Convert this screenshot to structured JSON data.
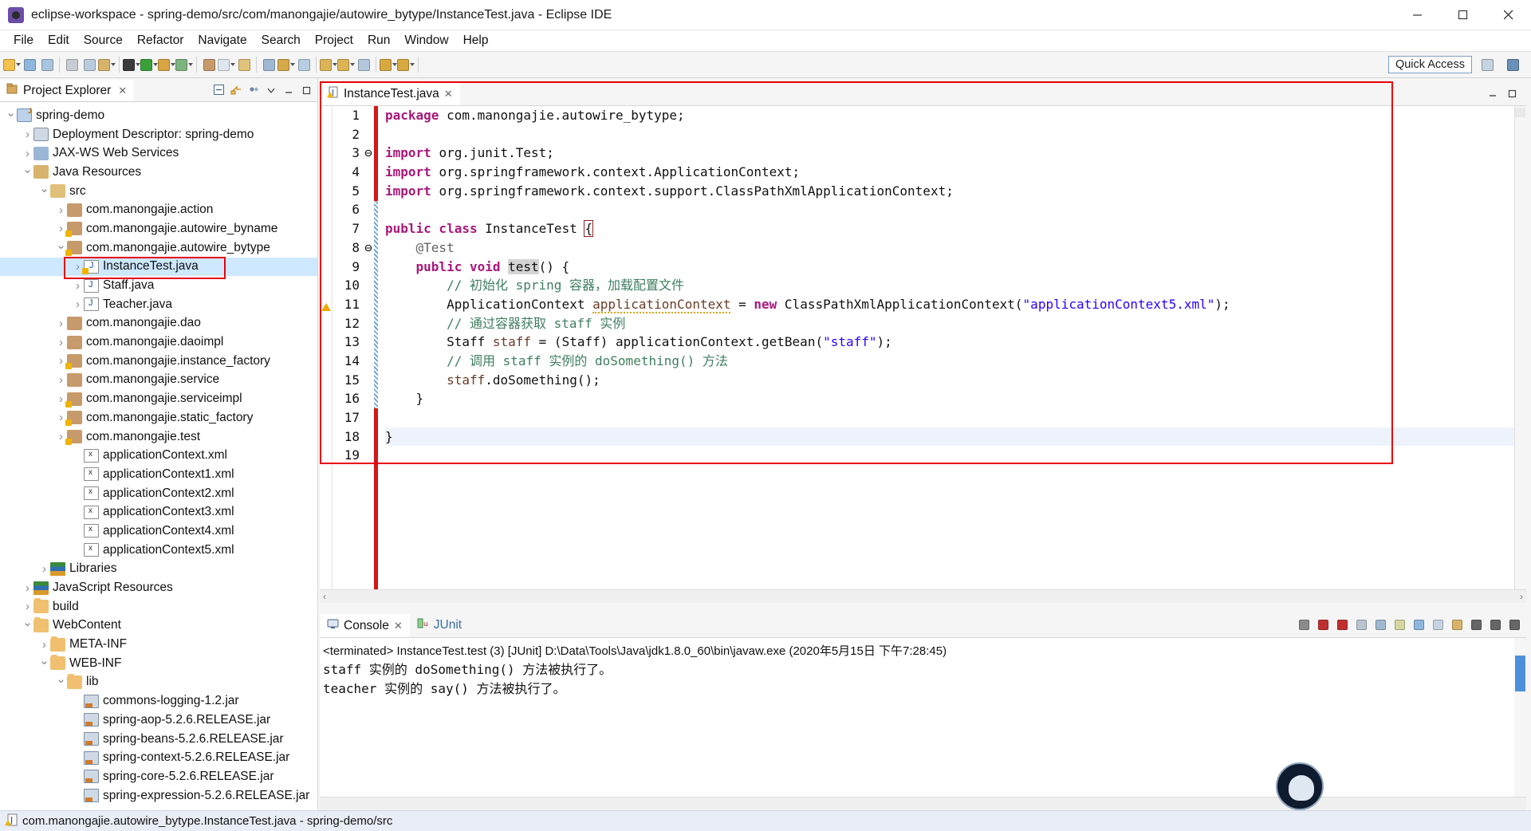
{
  "window": {
    "title": "eclipse-workspace - spring-demo/src/com/manongajie/autowire_bytype/InstanceTest.java - Eclipse IDE",
    "app_icon": "eclipse-icon",
    "minimize_label": "–",
    "maximize_label": "❐",
    "close_label": "✕"
  },
  "menubar": {
    "items": [
      "File",
      "Edit",
      "Source",
      "Refactor",
      "Navigate",
      "Search",
      "Project",
      "Run",
      "Window",
      "Help"
    ]
  },
  "toolbar": {
    "quick_access_label": "Quick Access",
    "groups": [
      [
        {
          "name": "new-wizard-icon",
          "color": "#f2c14e",
          "caret": true
        },
        {
          "name": "save-icon",
          "color": "#8fb7dd",
          "caret": false
        },
        {
          "name": "save-all-icon",
          "color": "#a8c4de",
          "caret": false
        }
      ],
      [
        {
          "name": "print-icon",
          "color": "#c8cdd4",
          "caret": false
        },
        {
          "name": "build-all-icon",
          "color": "#b9ccde",
          "caret": false
        },
        {
          "name": "export-icon",
          "color": "#d8b46b",
          "caret": true
        }
      ],
      [
        {
          "name": "debug-icon",
          "color": "#3b3b3b",
          "caret": true
        },
        {
          "name": "run-icon",
          "color": "#3aa03a",
          "caret": true
        },
        {
          "name": "run-external-tools-icon",
          "color": "#d9a441",
          "caret": true
        },
        {
          "name": "coverage-icon",
          "color": "#7db37d",
          "caret": true
        }
      ],
      [
        {
          "name": "new-java-package-icon",
          "color": "#c79a6b",
          "caret": false
        },
        {
          "name": "new-java-class-icon",
          "color": "#dfe6ee",
          "caret": true
        },
        {
          "name": "new-annotation-icon",
          "color": "#e0c27a",
          "caret": false
        }
      ],
      [
        {
          "name": "search-icon",
          "color": "#9fb8d2",
          "caret": false
        },
        {
          "name": "open-task-icon",
          "color": "#d6a94b",
          "caret": true
        },
        {
          "name": "open-type-icon",
          "color": "#b6cde2",
          "caret": false
        }
      ],
      [
        {
          "name": "next-annotation-icon",
          "color": "#dcb455",
          "caret": true
        },
        {
          "name": "previous-annotation-icon",
          "color": "#dcb455",
          "caret": true
        },
        {
          "name": "last-edit-location-icon",
          "color": "#b2c7dc",
          "caret": false
        }
      ],
      [
        {
          "name": "back-icon",
          "color": "#d8a93f",
          "caret": true
        },
        {
          "name": "forward-icon",
          "color": "#d8a93f",
          "caret": true
        }
      ]
    ],
    "perspective_buttons": [
      {
        "name": "open-perspective-icon",
        "color": "#c6d4e2"
      },
      {
        "name": "java-ee-perspective-icon",
        "color": "#6b90b8"
      }
    ]
  },
  "explorer": {
    "tab_label": "Project Explorer",
    "tab_close": "✕",
    "tools": [
      {
        "name": "collapse-all-icon"
      },
      {
        "name": "link-with-editor-icon"
      },
      {
        "name": "view-menu-icon"
      },
      {
        "name": "minimize-view-icon"
      },
      {
        "name": "maximize-view-icon"
      }
    ],
    "tree": [
      {
        "label": "spring-demo",
        "depth": 0,
        "arrow": "open",
        "icon": "ic-proj",
        "selected": false,
        "boxed": false
      },
      {
        "label": "Deployment Descriptor: spring-demo",
        "depth": 1,
        "arrow": "closed",
        "icon": "ic-deploy",
        "selected": false,
        "boxed": false
      },
      {
        "label": "JAX-WS Web Services",
        "depth": 1,
        "arrow": "closed",
        "icon": "ic-jaxws",
        "selected": false,
        "boxed": false
      },
      {
        "label": "Java Resources",
        "depth": 1,
        "arrow": "open",
        "icon": "ic-jres",
        "selected": false,
        "boxed": false
      },
      {
        "label": "src",
        "depth": 2,
        "arrow": "open",
        "icon": "ic-src",
        "selected": false,
        "boxed": false
      },
      {
        "label": "com.manongajie.action",
        "depth": 3,
        "arrow": "closed",
        "icon": "ic-pkg",
        "selected": false,
        "boxed": false
      },
      {
        "label": "com.manongajie.autowire_byname",
        "depth": 3,
        "arrow": "closed",
        "icon": "ic-pkgw",
        "selected": false,
        "boxed": false
      },
      {
        "label": "com.manongajie.autowire_bytype",
        "depth": 3,
        "arrow": "open",
        "icon": "ic-pkgw",
        "selected": false,
        "boxed": false
      },
      {
        "label": "InstanceTest.java",
        "depth": 4,
        "arrow": "closed",
        "icon": "ic-javaw",
        "selected": true,
        "boxed": true
      },
      {
        "label": "Staff.java",
        "depth": 4,
        "arrow": "closed",
        "icon": "ic-java",
        "selected": false,
        "boxed": false
      },
      {
        "label": "Teacher.java",
        "depth": 4,
        "arrow": "closed",
        "icon": "ic-java",
        "selected": false,
        "boxed": false
      },
      {
        "label": "com.manongajie.dao",
        "depth": 3,
        "arrow": "closed",
        "icon": "ic-pkg",
        "selected": false,
        "boxed": false
      },
      {
        "label": "com.manongajie.daoimpl",
        "depth": 3,
        "arrow": "closed",
        "icon": "ic-pkg",
        "selected": false,
        "boxed": false
      },
      {
        "label": "com.manongajie.instance_factory",
        "depth": 3,
        "arrow": "closed",
        "icon": "ic-pkgw",
        "selected": false,
        "boxed": false
      },
      {
        "label": "com.manongajie.service",
        "depth": 3,
        "arrow": "closed",
        "icon": "ic-pkg",
        "selected": false,
        "boxed": false
      },
      {
        "label": "com.manongajie.serviceimpl",
        "depth": 3,
        "arrow": "closed",
        "icon": "ic-pkgw",
        "selected": false,
        "boxed": false
      },
      {
        "label": "com.manongajie.static_factory",
        "depth": 3,
        "arrow": "closed",
        "icon": "ic-pkgw",
        "selected": false,
        "boxed": false
      },
      {
        "label": "com.manongajie.test",
        "depth": 3,
        "arrow": "closed",
        "icon": "ic-pkgw",
        "selected": false,
        "boxed": false
      },
      {
        "label": "applicationContext.xml",
        "depth": 4,
        "arrow": "none",
        "icon": "ic-xml",
        "selected": false,
        "boxed": false
      },
      {
        "label": "applicationContext1.xml",
        "depth": 4,
        "arrow": "none",
        "icon": "ic-xml",
        "selected": false,
        "boxed": false
      },
      {
        "label": "applicationContext2.xml",
        "depth": 4,
        "arrow": "none",
        "icon": "ic-xml",
        "selected": false,
        "boxed": false
      },
      {
        "label": "applicationContext3.xml",
        "depth": 4,
        "arrow": "none",
        "icon": "ic-xml",
        "selected": false,
        "boxed": false
      },
      {
        "label": "applicationContext4.xml",
        "depth": 4,
        "arrow": "none",
        "icon": "ic-xml",
        "selected": false,
        "boxed": false
      },
      {
        "label": "applicationContext5.xml",
        "depth": 4,
        "arrow": "none",
        "icon": "ic-xml",
        "selected": false,
        "boxed": false
      },
      {
        "label": "Libraries",
        "depth": 2,
        "arrow": "closed",
        "icon": "ic-lib",
        "selected": false,
        "boxed": false
      },
      {
        "label": "JavaScript Resources",
        "depth": 1,
        "arrow": "closed",
        "icon": "ic-lib",
        "selected": false,
        "boxed": false
      },
      {
        "label": "build",
        "depth": 1,
        "arrow": "closed",
        "icon": "ic-folder",
        "selected": false,
        "boxed": false
      },
      {
        "label": "WebContent",
        "depth": 1,
        "arrow": "open",
        "icon": "ic-folder",
        "selected": false,
        "boxed": false
      },
      {
        "label": "META-INF",
        "depth": 2,
        "arrow": "closed",
        "icon": "ic-folder",
        "selected": false,
        "boxed": false
      },
      {
        "label": "WEB-INF",
        "depth": 2,
        "arrow": "open",
        "icon": "ic-folder",
        "selected": false,
        "boxed": false
      },
      {
        "label": "lib",
        "depth": 3,
        "arrow": "open",
        "icon": "ic-folder",
        "selected": false,
        "boxed": false
      },
      {
        "label": "commons-logging-1.2.jar",
        "depth": 4,
        "arrow": "none",
        "icon": "ic-jar",
        "selected": false,
        "boxed": false
      },
      {
        "label": "spring-aop-5.2.6.RELEASE.jar",
        "depth": 4,
        "arrow": "none",
        "icon": "ic-jar",
        "selected": false,
        "boxed": false
      },
      {
        "label": "spring-beans-5.2.6.RELEASE.jar",
        "depth": 4,
        "arrow": "none",
        "icon": "ic-jar",
        "selected": false,
        "boxed": false
      },
      {
        "label": "spring-context-5.2.6.RELEASE.jar",
        "depth": 4,
        "arrow": "none",
        "icon": "ic-jar",
        "selected": false,
        "boxed": false
      },
      {
        "label": "spring-core-5.2.6.RELEASE.jar",
        "depth": 4,
        "arrow": "none",
        "icon": "ic-jar",
        "selected": false,
        "boxed": false
      },
      {
        "label": "spring-expression-5.2.6.RELEASE.jar",
        "depth": 4,
        "arrow": "none",
        "icon": "ic-jar",
        "selected": false,
        "boxed": false
      }
    ]
  },
  "editor": {
    "tab_label": "InstanceTest.java",
    "tab_close": "✕",
    "tab_icon": "java-warning-file-icon",
    "line_numbers": [
      "1",
      "2",
      "3",
      "4",
      "5",
      "6",
      "7",
      "8",
      "9",
      "10",
      "11",
      "12",
      "13",
      "14",
      "15",
      "16",
      "17",
      "18",
      "19"
    ],
    "fold_markers": {
      "3": "⊖",
      "8": "⊖"
    },
    "warning_line": 11,
    "current_line": 18,
    "code_lines": [
      {
        "n": 1,
        "segments": [
          {
            "t": "package ",
            "c": "k"
          },
          {
            "t": "com.manongajie.autowire_bytype;",
            "c": ""
          }
        ]
      },
      {
        "n": 2,
        "segments": []
      },
      {
        "n": 3,
        "segments": [
          {
            "t": "import ",
            "c": "k"
          },
          {
            "t": "org.junit.Test;",
            "c": ""
          }
        ]
      },
      {
        "n": 4,
        "segments": [
          {
            "t": "import ",
            "c": "k"
          },
          {
            "t": "org.springframework.context.ApplicationContext;",
            "c": ""
          }
        ]
      },
      {
        "n": 5,
        "segments": [
          {
            "t": "import ",
            "c": "k"
          },
          {
            "t": "org.springframework.context.support.ClassPathXmlApplicationContext;",
            "c": ""
          }
        ]
      },
      {
        "n": 6,
        "segments": []
      },
      {
        "n": 7,
        "segments": [
          {
            "t": "public class ",
            "c": "k"
          },
          {
            "t": "InstanceTest ",
            "c": ""
          },
          {
            "t": "{",
            "c": "brk-box"
          }
        ]
      },
      {
        "n": 8,
        "segments": [
          {
            "t": "    ",
            "c": ""
          },
          {
            "t": "@Test",
            "c": "ann"
          }
        ]
      },
      {
        "n": 9,
        "segments": [
          {
            "t": "    ",
            "c": ""
          },
          {
            "t": "public void ",
            "c": "k"
          },
          {
            "t": "test",
            "c": "sel-tok"
          },
          {
            "t": "() {",
            "c": ""
          }
        ]
      },
      {
        "n": 10,
        "segments": [
          {
            "t": "        ",
            "c": ""
          },
          {
            "t": "// 初始化 spring 容器，加载配置文件",
            "c": "cmt"
          }
        ]
      },
      {
        "n": 11,
        "segments": [
          {
            "t": "        ApplicationContext ",
            "c": ""
          },
          {
            "t": "applicationContext",
            "c": "loc squiggle"
          },
          {
            "t": " = ",
            "c": ""
          },
          {
            "t": "new ",
            "c": "k"
          },
          {
            "t": "ClassPathXmlApplicationContext(",
            "c": ""
          },
          {
            "t": "\"applicationContext5.xml\"",
            "c": "str"
          },
          {
            "t": ");",
            "c": ""
          }
        ]
      },
      {
        "n": 12,
        "segments": [
          {
            "t": "        ",
            "c": ""
          },
          {
            "t": "// 通过容器获取 staff 实例",
            "c": "cmt"
          }
        ]
      },
      {
        "n": 13,
        "segments": [
          {
            "t": "        Staff ",
            "c": ""
          },
          {
            "t": "staff",
            "c": "loc"
          },
          {
            "t": " = (Staff) applicationContext.getBean(",
            "c": ""
          },
          {
            "t": "\"staff\"",
            "c": "str"
          },
          {
            "t": ");",
            "c": ""
          }
        ]
      },
      {
        "n": 14,
        "segments": [
          {
            "t": "        ",
            "c": ""
          },
          {
            "t": "// 调用 staff 实例的 doSomething() 方法",
            "c": "cmt"
          }
        ]
      },
      {
        "n": 15,
        "segments": [
          {
            "t": "        ",
            "c": ""
          },
          {
            "t": "staff",
            "c": "loc"
          },
          {
            "t": ".doSomething();",
            "c": ""
          }
        ]
      },
      {
        "n": 16,
        "segments": [
          {
            "t": "    }",
            "c": ""
          }
        ]
      },
      {
        "n": 17,
        "segments": []
      },
      {
        "n": 18,
        "segments": [
          {
            "t": "}",
            "c": ""
          }
        ]
      },
      {
        "n": 19,
        "segments": []
      }
    ]
  },
  "console": {
    "tabs": [
      {
        "label": "Console",
        "icon": "console-icon",
        "active": true,
        "close": "✕"
      },
      {
        "label": "JUnit",
        "icon": "junit-icon",
        "active": false,
        "close": ""
      }
    ],
    "tools": [
      {
        "name": "terminate-icon"
      },
      {
        "name": "remove-launch-icon"
      },
      {
        "name": "remove-all-terminated-icon"
      },
      {
        "name": "clear-console-icon"
      },
      {
        "name": "scroll-lock-icon"
      },
      {
        "name": "word-wrap-icon"
      },
      {
        "name": "pin-console-icon"
      },
      {
        "name": "display-selected-console-icon"
      },
      {
        "name": "open-console-icon"
      },
      {
        "name": "view-menu-icon"
      },
      {
        "name": "minimize-view-icon"
      },
      {
        "name": "maximize-view-icon"
      }
    ],
    "process_line": "<terminated> InstanceTest.test (3) [JUnit] D:\\Data\\Tools\\Java\\jdk1.8.0_60\\bin\\javaw.exe (2020年5月15日 下午7:28:45)",
    "output_lines": [
      "staff 实例的 doSomething() 方法被执行了。",
      "teacher 实例的 say() 方法被执行了。"
    ]
  },
  "statusbar": {
    "text": "com.manongajie.autowire_bytype.InstanceTest.java - spring-demo/src",
    "icon": "java-warning-file-icon"
  },
  "colors": {
    "highlight_red": "#e8000a",
    "selection_blue": "#cde8ff",
    "keyword": "#a8187a",
    "string": "#2a00ff",
    "comment": "#3f7f5f",
    "local_var": "#6a3c28"
  }
}
